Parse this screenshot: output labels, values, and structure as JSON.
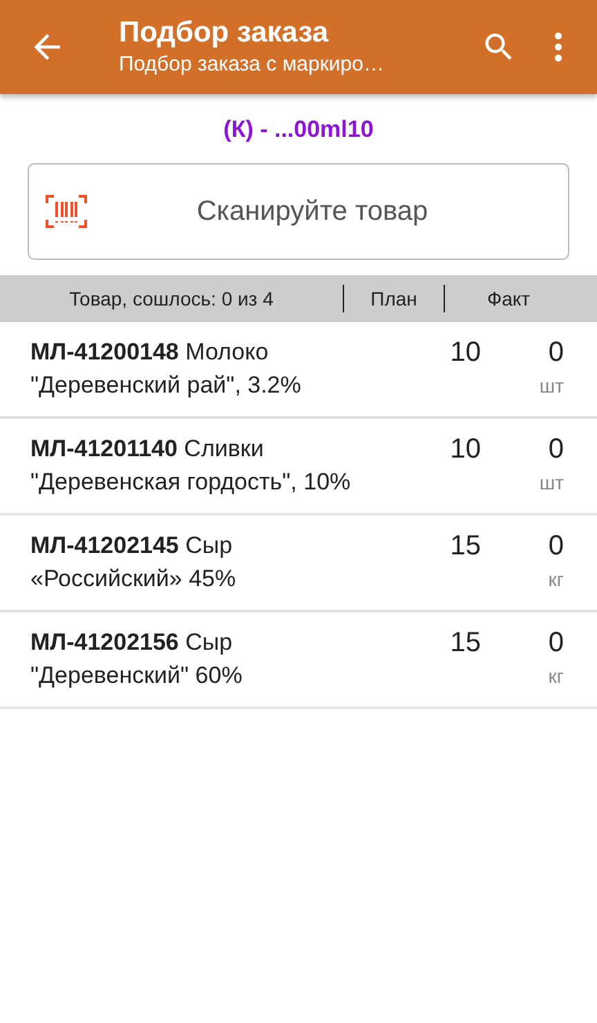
{
  "app_bar": {
    "title": "Подбор заказа",
    "subtitle": "Подбор заказа с маркиро…"
  },
  "order_code": "(К) - ...00ml10",
  "scan_field": {
    "placeholder": "Сканируйте товар"
  },
  "table": {
    "columns": [
      "Товар, сошлось: 0 из 4",
      "План",
      "Факт"
    ],
    "rows": [
      {
        "name": "**МЛ-41200148** Молоко \"Деревенский рай\", 3.2%",
        "plan": "10",
        "fact": "0",
        "unit": "шт"
      },
      {
        "name": "**МЛ-41201140** Сливки \"Деревенская гордость\", 10%",
        "plan": "10",
        "fact": "0",
        "unit": "шт"
      },
      {
        "name": "**МЛ-41202145** Сыр «Российский» 45%",
        "plan": "15",
        "fact": "0",
        "unit": "кг"
      },
      {
        "name": "**МЛ-41202156** Сыр \"Деревенский\" 60%",
        "plan": "15",
        "fact": "0",
        "unit": "кг"
      }
    ]
  }
}
